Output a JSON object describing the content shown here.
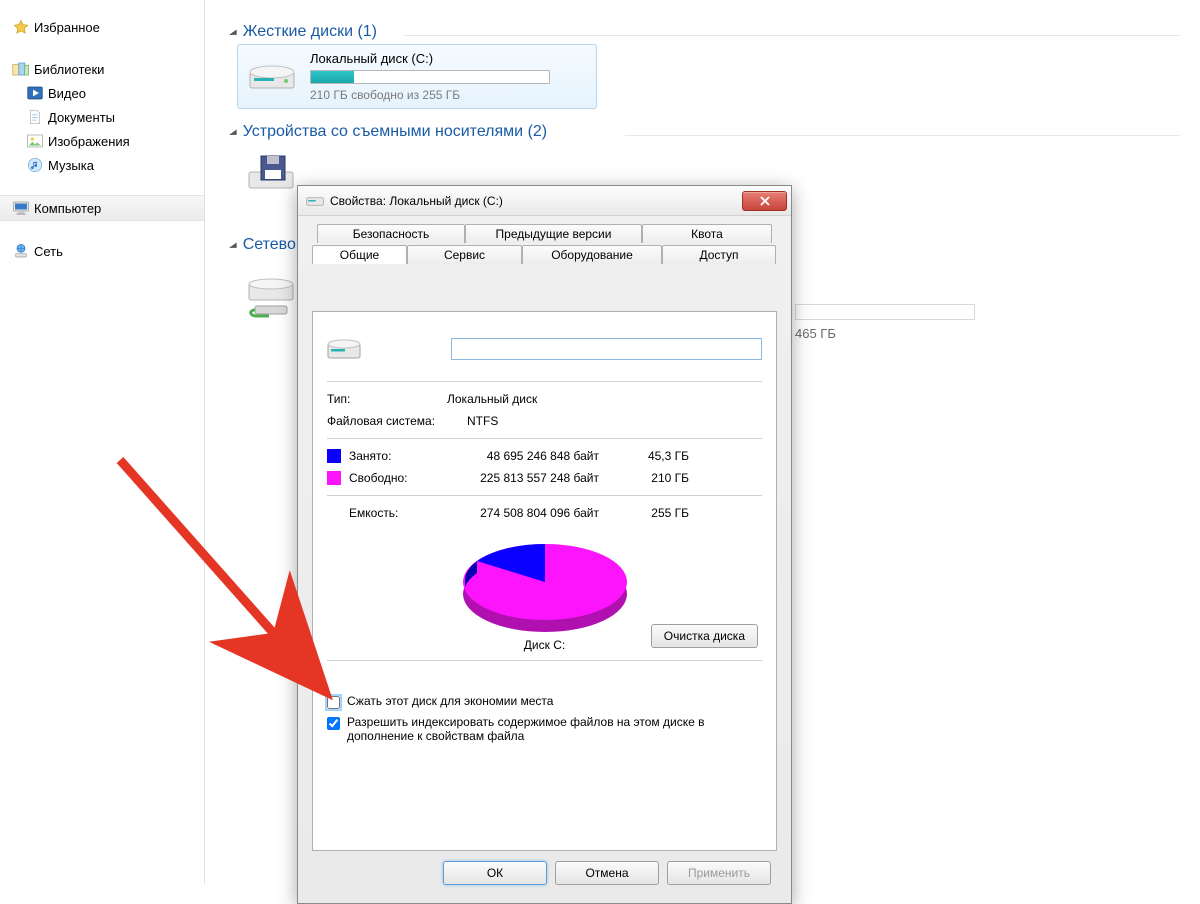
{
  "nav": {
    "favorites": "Избранное",
    "libraries": "Библиотеки",
    "video": "Видео",
    "documents": "Документы",
    "images": "Изображения",
    "music": "Музыка",
    "computer": "Компьютер",
    "network": "Сеть"
  },
  "sections": {
    "hard_drives": "Жесткие диски (1)",
    "removable": "Устройства со съемными носителями (2)",
    "network_loc": "Сетево"
  },
  "drive_c": {
    "name": "Локальный диск (C:)",
    "free_line": "210 ГБ свободно из 255 ГБ",
    "fill_percent": 18
  },
  "bg_frag": "465 ГБ",
  "dialog": {
    "title": "Свойства: Локальный диск (C:)",
    "tabs_top": [
      "Безопасность",
      "Предыдущие версии",
      "Квота"
    ],
    "tabs_bottom": [
      "Общие",
      "Сервис",
      "Оборудование",
      "Доступ"
    ],
    "type_label": "Тип:",
    "type_value": "Локальный диск",
    "fs_label": "Файловая система:",
    "fs_value": "NTFS",
    "used_label": "Занято:",
    "used_bytes": "48 695 246 848 байт",
    "used_gb": "45,3 ГБ",
    "free_label": "Свободно:",
    "free_bytes": "225 813 557 248 байт",
    "free_gb": "210 ГБ",
    "capacity_label": "Емкость:",
    "capacity_bytes": "274 508 804 096 байт",
    "capacity_gb": "255 ГБ",
    "disk_caption": "Диск C:",
    "cleanup_btn": "Очистка диска",
    "compress_label": "Сжать этот диск для экономии места",
    "index_label": "Разрешить индексировать содержимое файлов на этом диске в дополнение к свойствам файла",
    "ok": "ОК",
    "cancel": "Отмена",
    "apply": "Применить"
  },
  "chart_data": {
    "type": "pie",
    "title": "Диск C:",
    "series": [
      {
        "name": "Занято",
        "value": 48695246848,
        "value_gb": 45.3,
        "color": "#0b00ff"
      },
      {
        "name": "Свободно",
        "value": 225813557248,
        "value_gb": 210,
        "color": "#fc14fc"
      }
    ],
    "total": 274508804096,
    "total_gb": 255,
    "unit": "байт"
  }
}
